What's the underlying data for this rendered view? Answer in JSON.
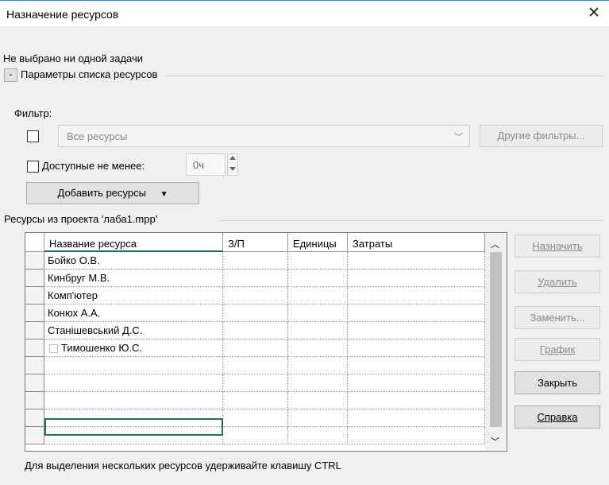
{
  "window": {
    "title": "Назначение ресурсов",
    "close_glyph": "✕"
  },
  "status_line": "Не выбрано ни одной задачи",
  "section": {
    "toggle": "-",
    "label": "Параметры списка ресурсов"
  },
  "filter": {
    "label": "Фильтр:",
    "select_value": "Все ресурсы",
    "other_filters_button": "Другие фильтры..."
  },
  "available": {
    "label": "Доступные не менее:",
    "value": "0ч"
  },
  "add_resources_button": "Добавить ресурсы",
  "resources_group_label": "Ресурсы из проекта 'лаба1.mpp'",
  "table": {
    "columns": [
      "Название ресурса",
      "З/П",
      "Единицы",
      "Затраты"
    ],
    "rows": [
      {
        "name": "Бойко О.В."
      },
      {
        "name": "Кинбруг М.В."
      },
      {
        "name": "Комп'ютер"
      },
      {
        "name": "Конюх А.А."
      },
      {
        "name": "Станішевський Д.С."
      },
      {
        "name": "Тимошенко Ю.С."
      }
    ]
  },
  "side_buttons": {
    "assign": "Назначить",
    "remove": "Удалить",
    "replace": "Заменить...",
    "graph": "График",
    "close": "Закрыть",
    "help": "Справка"
  },
  "hint": "Для выделения нескольких ресурсов удерживайте клавишу CTRL"
}
